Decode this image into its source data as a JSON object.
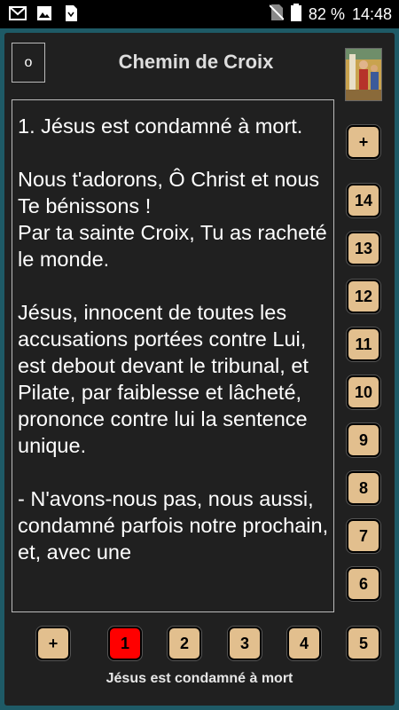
{
  "status_bar": {
    "battery": "82 %",
    "time": "14:48",
    "icons_left": [
      "gmail-icon",
      "image-icon",
      "download-icon"
    ],
    "icons_right": [
      "no-sim-icon",
      "battery-icon"
    ]
  },
  "header": {
    "o_button_label": "o",
    "title": "Chemin de Croix"
  },
  "station_text": [
    "1. Jésus est condamné à mort.",
    "Nous t'adorons, Ô Christ et nous Te bénissons !\nPar ta sainte Croix, Tu as racheté le monde.",
    "Jésus, innocent de toutes les accusations portées contre Lui, est debout devant le tribunal, et Pilate, par faiblesse et lâcheté, prononce contre lui la sentence unique.",
    "- N'avons-nous pas, nous aussi, condamné parfois notre prochain, et, avec une"
  ],
  "side_buttons": [
    "+",
    "14",
    "13",
    "12",
    "11",
    "10",
    "9",
    "8",
    "7",
    "6"
  ],
  "bottom_buttons": [
    "+",
    "1",
    "2",
    "3",
    "4",
    "5"
  ],
  "active_station": "1",
  "caption": "Jésus est condamné à mort",
  "colors": {
    "background": "#1e5a66",
    "panel": "#202020",
    "button": "#e2bf8e",
    "active_button": "#ff0000"
  }
}
